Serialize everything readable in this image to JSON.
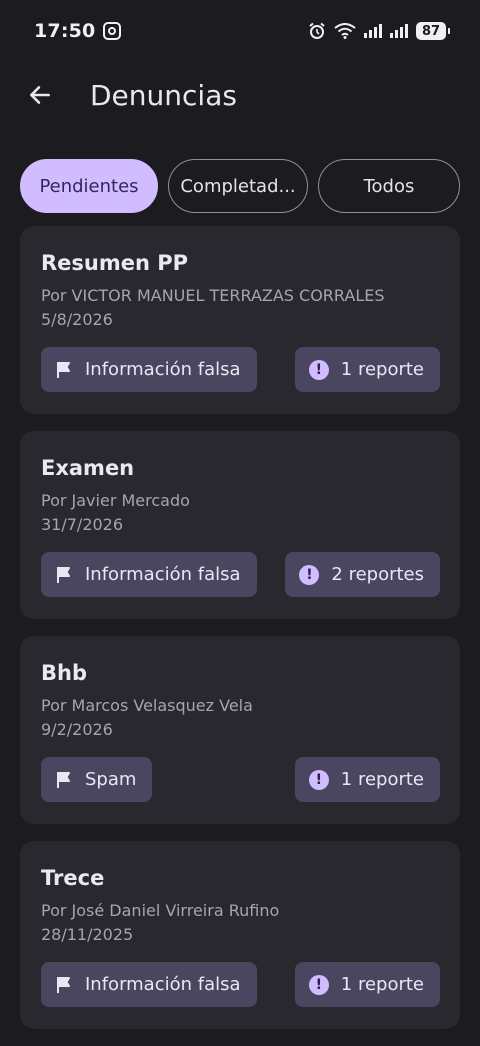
{
  "status_bar": {
    "time": "17:50",
    "battery": "87"
  },
  "header": {
    "title": "Denuncias"
  },
  "tabs": [
    {
      "label": "Pendientes",
      "active": true
    },
    {
      "label": "Completad...",
      "active": false
    },
    {
      "label": "Todos",
      "active": false
    }
  ],
  "reports": [
    {
      "title": "Resumen PP",
      "author": "Por VICTOR MANUEL TERRAZAS CORRALES",
      "date": "5/8/2026",
      "reason": "Información falsa",
      "count": "1 reporte"
    },
    {
      "title": "Examen",
      "author": "Por Javier Mercado",
      "date": "31/7/2026",
      "reason": "Información falsa",
      "count": "2 reportes"
    },
    {
      "title": "Bhb",
      "author": "Por Marcos Velasquez Vela",
      "date": "9/2/2026",
      "reason": "Spam",
      "count": "1 reporte"
    },
    {
      "title": "Trece",
      "author": "Por José Daniel Virreira Rufino",
      "date": "28/11/2025",
      "reason": "Información falsa",
      "count": "1 reporte"
    }
  ],
  "colors": {
    "background": "#1c1b20",
    "card": "#2a282f",
    "accent": "#d0bcff",
    "chip": "#4b4660"
  },
  "icons": {
    "back": "arrow-back-icon",
    "reason": "flag-icon",
    "count": "alert-circle-icon"
  }
}
